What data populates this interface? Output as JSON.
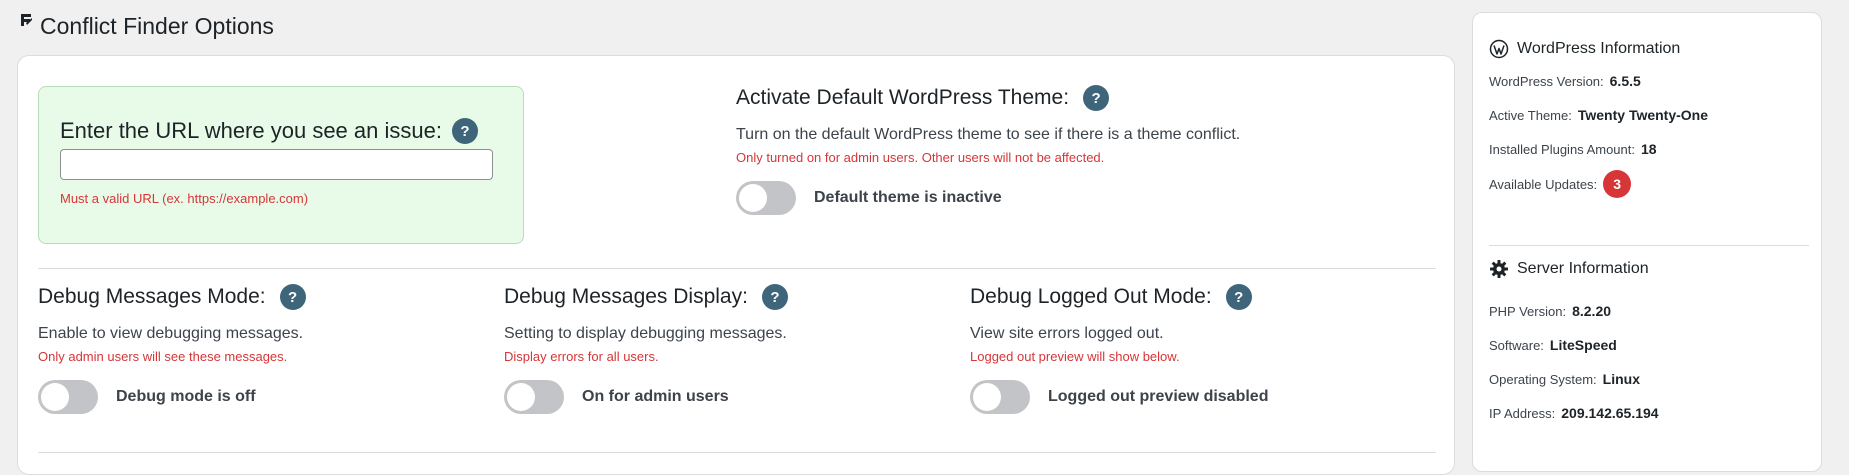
{
  "page": {
    "title": "Conflict Finder Options"
  },
  "url_box": {
    "label": "Enter the URL where you see an issue:",
    "help": "?",
    "input_value": "",
    "hint": "Must a valid URL (ex. https://example.com)"
  },
  "default_theme": {
    "title": "Activate Default WordPress Theme:",
    "help": "?",
    "description": "Turn on the default WordPress theme to see if there is a theme conflict.",
    "warning": "Only turned on for admin users. Other users will not be affected.",
    "toggle_label": "Default theme is inactive",
    "toggle_on": false
  },
  "debug_mode": {
    "title": "Debug Messages Mode:",
    "help": "?",
    "description": "Enable to view debugging messages.",
    "warning": "Only admin users will see these messages.",
    "toggle_label": "Debug mode is off",
    "toggle_on": false
  },
  "debug_display": {
    "title": "Debug Messages Display:",
    "help": "?",
    "description": "Setting to display debugging messages.",
    "warning": "Display errors for all users.",
    "toggle_label": "On for admin users",
    "toggle_on": false
  },
  "debug_logged_out": {
    "title": "Debug Logged Out Mode:",
    "help": "?",
    "description": "View site errors logged out.",
    "warning": "Logged out preview will show below.",
    "toggle_label": "Logged out preview disabled",
    "toggle_on": false
  },
  "wordpress_info": {
    "title": "WordPress Information",
    "icon": "wordpress-icon",
    "version_label": "WordPress Version:",
    "version_value": "6.5.5",
    "theme_label": "Active Theme:",
    "theme_value": "Twenty Twenty-One",
    "plugins_label": "Installed Plugins Amount:",
    "plugins_value": "18",
    "updates_label": "Available Updates:",
    "updates_value": "3"
  },
  "server_info": {
    "title": "Server Information",
    "icon": "gear-icon",
    "php_label": "PHP Version:",
    "php_value": "8.2.20",
    "software_label": "Software:",
    "software_value": "LiteSpeed",
    "os_label": "Operating System:",
    "os_value": "Linux",
    "ip_label": "IP Address:",
    "ip_value": "209.142.65.194"
  },
  "colors": {
    "help_badge": "#3e6579",
    "warning_text": "#d63638",
    "url_box_bg": "#e8fbe8",
    "toggle_off": "#c3c4c7"
  }
}
